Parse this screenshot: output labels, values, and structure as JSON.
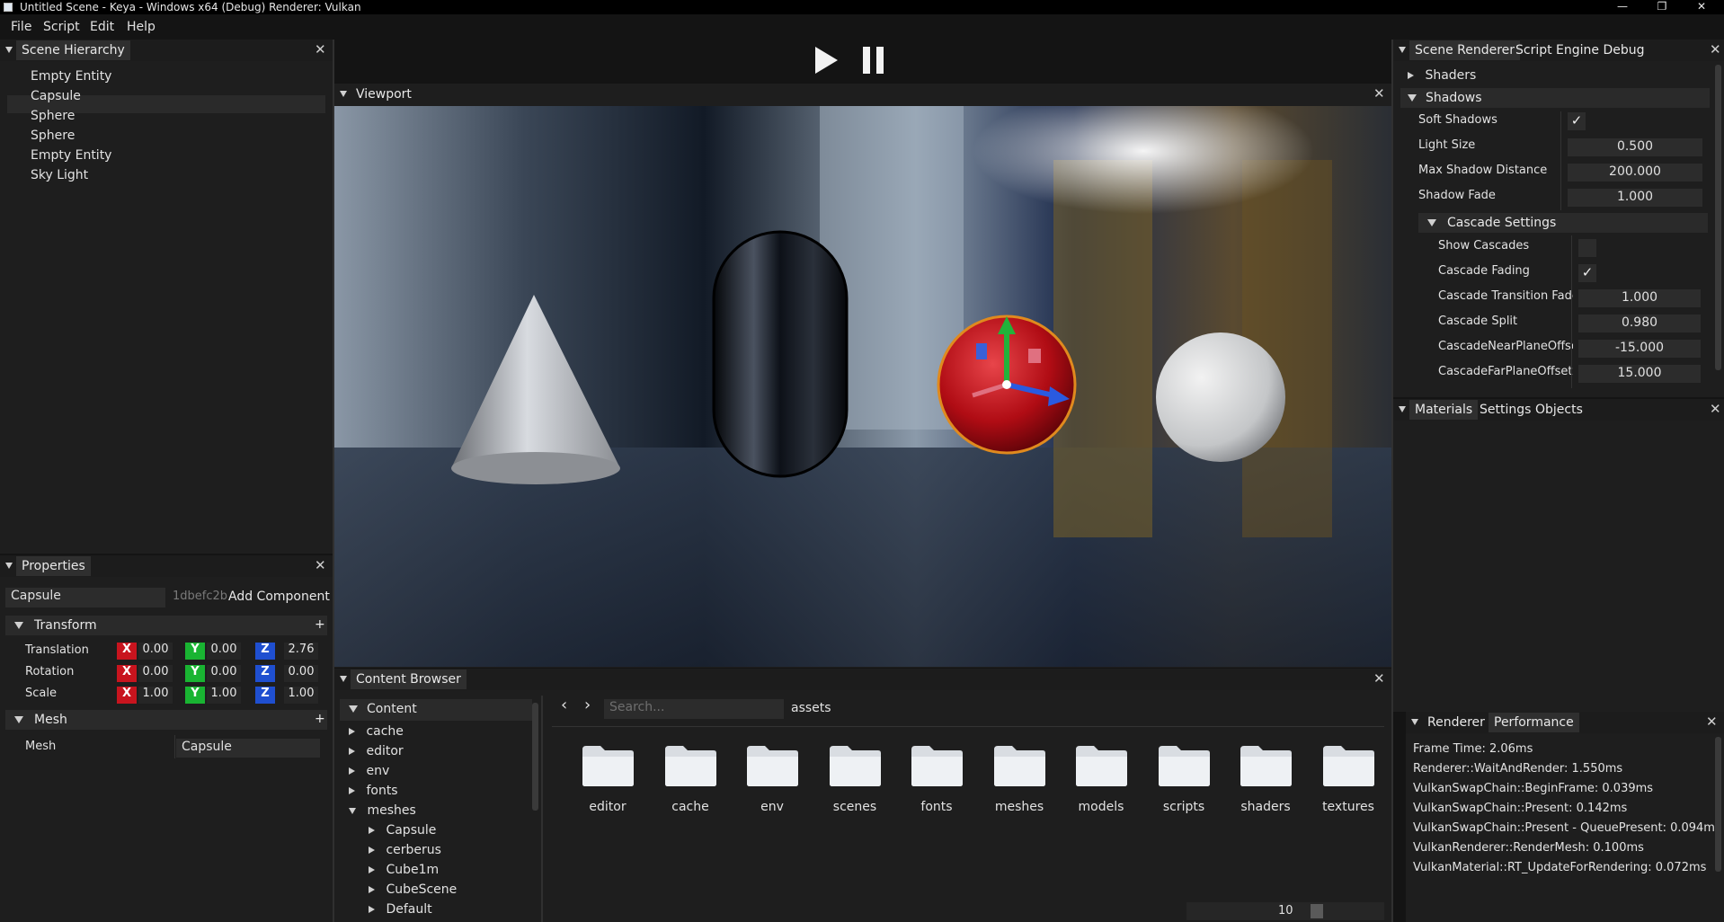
{
  "window": {
    "title": "Untitled Scene - Keya - Windows x64 (Debug) Renderer: Vulkan",
    "controls": [
      "—",
      "❐",
      "✕"
    ]
  },
  "menu": [
    "File",
    "Script",
    "Edit",
    "Help"
  ],
  "hierarchy": {
    "tab": "Scene Hierarchy",
    "items": [
      "Empty Entity",
      "Capsule",
      "Sphere",
      "Sphere",
      "Empty Entity",
      "Sky Light"
    ],
    "selected_index": 1
  },
  "playback": {
    "play": "play",
    "pause": "pause"
  },
  "viewport": {
    "tab": "Viewport"
  },
  "properties": {
    "tab": "Properties",
    "entity_name": "Capsule",
    "entity_id": "1dbefc2b",
    "add_component": "Add Component",
    "transform": {
      "header": "Transform",
      "add": "+",
      "rows": [
        {
          "label": "Translation",
          "x": "0.00",
          "y": "0.00",
          "z": "2.76"
        },
        {
          "label": "Rotation",
          "x": "0.00",
          "y": "0.00",
          "z": "0.00"
        },
        {
          "label": "Scale",
          "x": "1.00",
          "y": "1.00",
          "z": "1.00"
        }
      ],
      "axis": {
        "x": "X",
        "y": "Y",
        "z": "Z"
      }
    },
    "mesh": {
      "header": "Mesh",
      "add": "+",
      "label": "Mesh",
      "value": "Capsule"
    }
  },
  "scene_renderer": {
    "tabs": [
      "Scene Renderer",
      "Script Engine Debug"
    ],
    "shaders": "Shaders",
    "shadows": "Shadows",
    "soft_shadows": {
      "label": "Soft Shadows",
      "checked": true
    },
    "light_size": {
      "label": "Light Size",
      "value": "0.500"
    },
    "max_shadow_distance": {
      "label": "Max Shadow Distance",
      "value": "200.000"
    },
    "shadow_fade": {
      "label": "Shadow Fade",
      "value": "1.000"
    },
    "cascade_settings": "Cascade Settings",
    "show_cascades": {
      "label": "Show Cascades",
      "checked": false
    },
    "cascade_fading": {
      "label": "Cascade Fading",
      "checked": true
    },
    "cascade_transition_fade": {
      "label": "Cascade Transition Fade",
      "value": "1.000"
    },
    "cascade_split": {
      "label": "Cascade Split",
      "value": "0.980"
    },
    "cascade_near": {
      "label": "CascadeNearPlaneOffset",
      "value": "-15.000"
    },
    "cascade_far": {
      "label": "CascadeFarPlaneOffset",
      "value": "15.000"
    }
  },
  "materials_panel": {
    "tabs": [
      "Materials",
      "Settings",
      "Objects"
    ]
  },
  "performance": {
    "tabs": [
      "Renderer",
      "Performance"
    ],
    "lines": [
      "Frame Time: 2.06ms",
      "Renderer::WaitAndRender: 1.550ms",
      "VulkanSwapChain::BeginFrame: 0.039ms",
      "VulkanSwapChain::Present: 0.142ms",
      "VulkanSwapChain::Present - QueuePresent: 0.094ms",
      "VulkanRenderer::RenderMesh: 0.100ms",
      "VulkanMaterial::RT_UpdateForRendering: 0.072ms"
    ]
  },
  "content_browser": {
    "tab": "Content Browser",
    "root": "Content",
    "tree": [
      "cache",
      "editor",
      "env",
      "fonts",
      "meshes"
    ],
    "mesh_children": [
      "Capsule",
      "cerberus",
      "Cube1m",
      "CubeScene",
      "Default"
    ],
    "search_placeholder": "Search...",
    "path": "assets",
    "folders": [
      "editor",
      "cache",
      "env",
      "scenes",
      "fonts",
      "meshes",
      "models",
      "scripts",
      "shaders",
      "textures"
    ],
    "thumb_size": "10"
  },
  "colors": {
    "accent_orange": "#e08a1e",
    "axis_x": "#c8141e",
    "axis_y": "#19b432",
    "axis_z": "#1f4fd0"
  }
}
